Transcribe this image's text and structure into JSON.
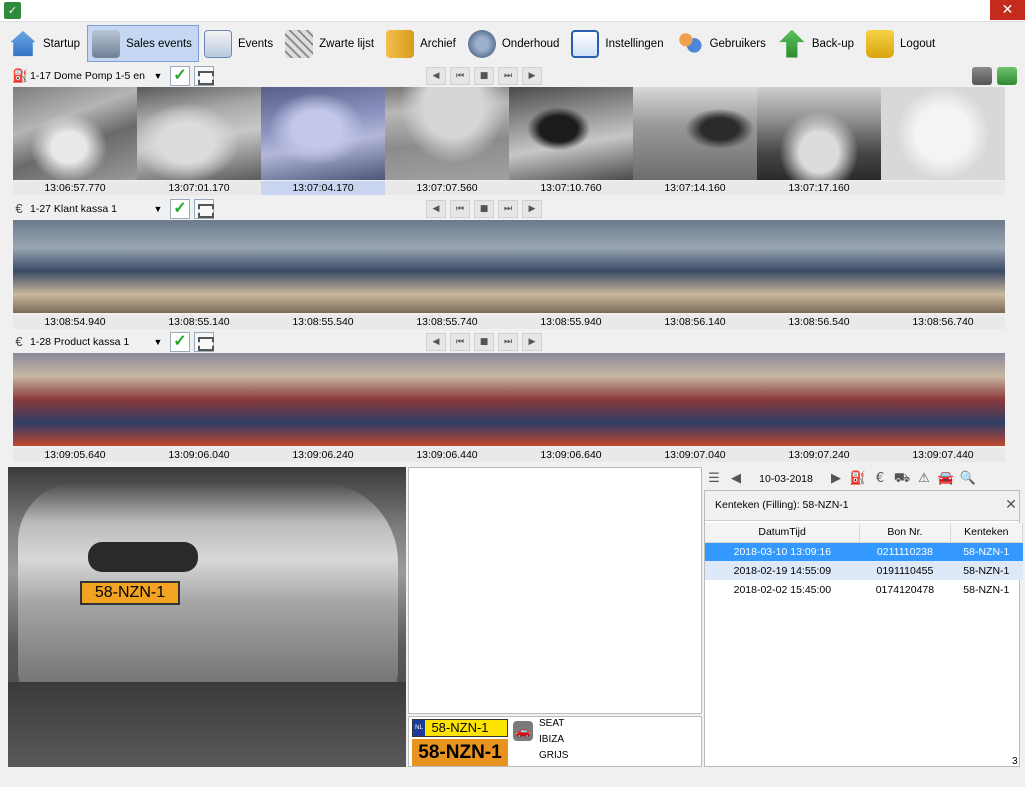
{
  "toolbar": {
    "items": [
      {
        "label": "Startup",
        "icon": "home-icon"
      },
      {
        "label": "Sales events",
        "icon": "cash-register-icon"
      },
      {
        "label": "Events",
        "icon": "events-icon"
      },
      {
        "label": "Zwarte lijst",
        "icon": "blacklist-icon"
      },
      {
        "label": "Archief",
        "icon": "archive-folder-icon"
      },
      {
        "label": "Onderhoud",
        "icon": "gears-icon"
      },
      {
        "label": "Instellingen",
        "icon": "settings-checklist-icon"
      },
      {
        "label": "Gebruikers",
        "icon": "users-icon"
      },
      {
        "label": "Back-up",
        "icon": "backup-arrow-icon"
      },
      {
        "label": "Logout",
        "icon": "padlock-icon"
      }
    ]
  },
  "strips": [
    {
      "selector": "1-17 Dome Pomp 1-5 en",
      "type_icon": "fuel-pump-icon",
      "times": [
        "13:06:57.770",
        "13:07:01.170",
        "13:07:04.170",
        "13:07:07.560",
        "13:07:10.760",
        "13:07:14.160",
        "13:07:17.160",
        ""
      ],
      "highlighted_index": 2
    },
    {
      "selector": "1-27 Klant kassa 1",
      "type_icon": "euro-icon",
      "times": [
        "13:08:54.940",
        "13:08:55.140",
        "13:08:55.540",
        "13:08:55.740",
        "13:08:55.940",
        "13:08:56.140",
        "13:08:56.540",
        "13:08:56.740"
      ]
    },
    {
      "selector": "1-28 Product kassa 1",
      "type_icon": "euro-icon",
      "times": [
        "13:09:05.640",
        "13:09:06.040",
        "13:09:06.240",
        "13:09:06.440",
        "13:09:06.640",
        "13:09:07.040",
        "13:09:07.240",
        "13:09:07.440"
      ]
    }
  ],
  "plate": {
    "text": "58-NZN-1",
    "country": "NL",
    "crop_text": "58-NZN-1"
  },
  "vehicle": {
    "make": "SEAT",
    "model": "IBIZA",
    "color": "GRIJS"
  },
  "right_panel": {
    "date": "10-03-2018",
    "title": "Kenteken (Filling): 58-NZN-1",
    "columns": [
      "DatumTijd",
      "Bon Nr.",
      "Kenteken"
    ],
    "rows": [
      {
        "datetime": "2018-03-10 13:09:16",
        "bon": "0211110238",
        "plate": "58-NZN-1"
      },
      {
        "datetime": "2018-02-19 14:55:09",
        "bon": "0191110455",
        "plate": "58-NZN-1"
      },
      {
        "datetime": "2018-02-02 15:45:00",
        "bon": "0174120478",
        "plate": "58-NZN-1"
      }
    ],
    "count": "3"
  },
  "colors": {
    "selection_blue": "#3399ff",
    "active_tab": "#c5d7f2",
    "plate_yellow": "#fde400",
    "check_green": "#26a826"
  }
}
